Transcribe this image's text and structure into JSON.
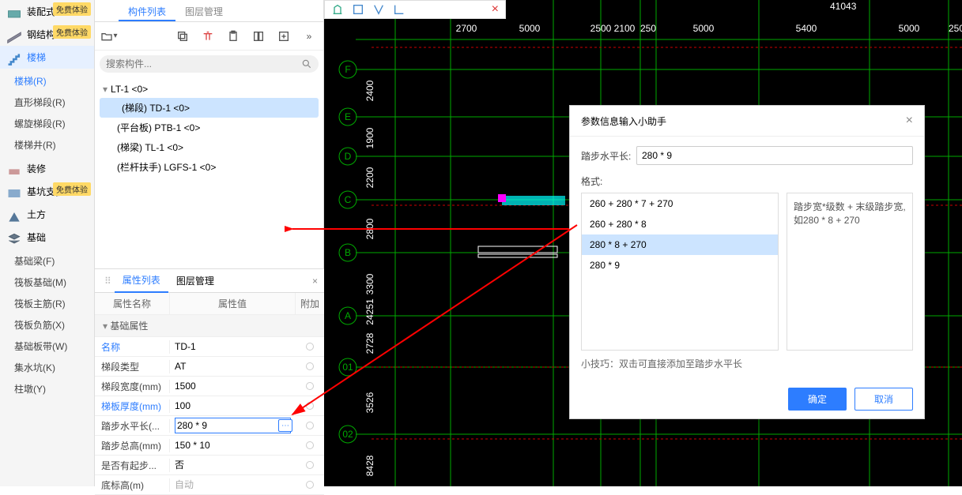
{
  "categories": [
    {
      "label": "装配式",
      "badge": "免费体验"
    },
    {
      "label": "钢结构",
      "badge": "免费体验"
    },
    {
      "label": "楼梯",
      "active": true,
      "subs": [
        {
          "label": "楼梯(R)",
          "active": true
        },
        {
          "label": "直形梯段(R)"
        },
        {
          "label": "螺旋梯段(R)"
        },
        {
          "label": "楼梯井(R)"
        }
      ]
    },
    {
      "label": "装修"
    },
    {
      "label": "基坑支护",
      "badge": "免费体验"
    },
    {
      "label": "土方"
    },
    {
      "label": "基础",
      "subs": [
        {
          "label": "基础梁(F)"
        },
        {
          "label": "筏板基础(M)"
        },
        {
          "label": "筏板主筋(R)"
        },
        {
          "label": "筏板负筋(X)"
        },
        {
          "label": "基础板带(W)"
        },
        {
          "label": "集水坑(K)"
        },
        {
          "label": "柱墩(Y)"
        }
      ]
    }
  ],
  "midTabs": [
    "构件列表",
    "图层管理"
  ],
  "searchPlaceholder": "搜索构件...",
  "tree": {
    "root": "LT-1 <0>",
    "children": [
      {
        "label": "(梯段) TD-1 <0>",
        "selected": true
      },
      {
        "label": "(平台板) PTB-1 <0>"
      },
      {
        "label": "(梯梁) TL-1 <0>"
      },
      {
        "label": "(栏杆扶手) LGFS-1 <0>"
      }
    ]
  },
  "propTabs": [
    "属性列表",
    "图层管理"
  ],
  "propHeaders": {
    "c1": "属性名称",
    "c2": "属性值",
    "c3": "附加"
  },
  "propSection": "基础属性",
  "props": [
    {
      "name": "名称",
      "value": "TD-1",
      "link": true
    },
    {
      "name": "梯段类型",
      "value": "AT"
    },
    {
      "name": "梯段宽度(mm)",
      "value": "1500"
    },
    {
      "name": "梯板厚度(mm)",
      "value": "100",
      "link": true
    },
    {
      "name": "踏步水平长(...",
      "value": "280 * 9",
      "ellipsis": true,
      "highlight": true
    },
    {
      "name": "踏步总高(mm)",
      "value": "150 * 10"
    },
    {
      "name": "是否有起步...",
      "value": "否"
    },
    {
      "name": "底标高(m)",
      "value": "自动",
      "gray": true
    }
  ],
  "dialog": {
    "title": "参数信息输入小助手",
    "fieldLabel": "踏步水平长:",
    "fieldValue": "280 * 9",
    "formatLabel": "格式:",
    "suggestions": [
      "260 + 280 * 7 + 270",
      "260 + 280 * 8",
      "280 * 8 + 270",
      "280 * 9"
    ],
    "selectedIndex": 2,
    "description": "踏步宽*级数 + 末级踏步宽, 如280 * 8 + 270",
    "tip": "小技巧：双击可直接添加至踏步水平长",
    "ok": "确定",
    "cancel": "取消"
  },
  "canvas": {
    "topNumbers": [
      "2700",
      "5000",
      "2500",
      "2100",
      "250",
      "5000",
      "5400",
      "5000",
      "250"
    ],
    "topLabelRight": "41043",
    "leftNumbers": [
      "2400",
      "1900",
      "2200",
      "2800",
      "3300",
      "24251",
      "2728",
      "3526",
      "8428"
    ],
    "axisLabels": [
      "F",
      "E",
      "D",
      "C",
      "B",
      "A",
      "01",
      "02"
    ]
  }
}
